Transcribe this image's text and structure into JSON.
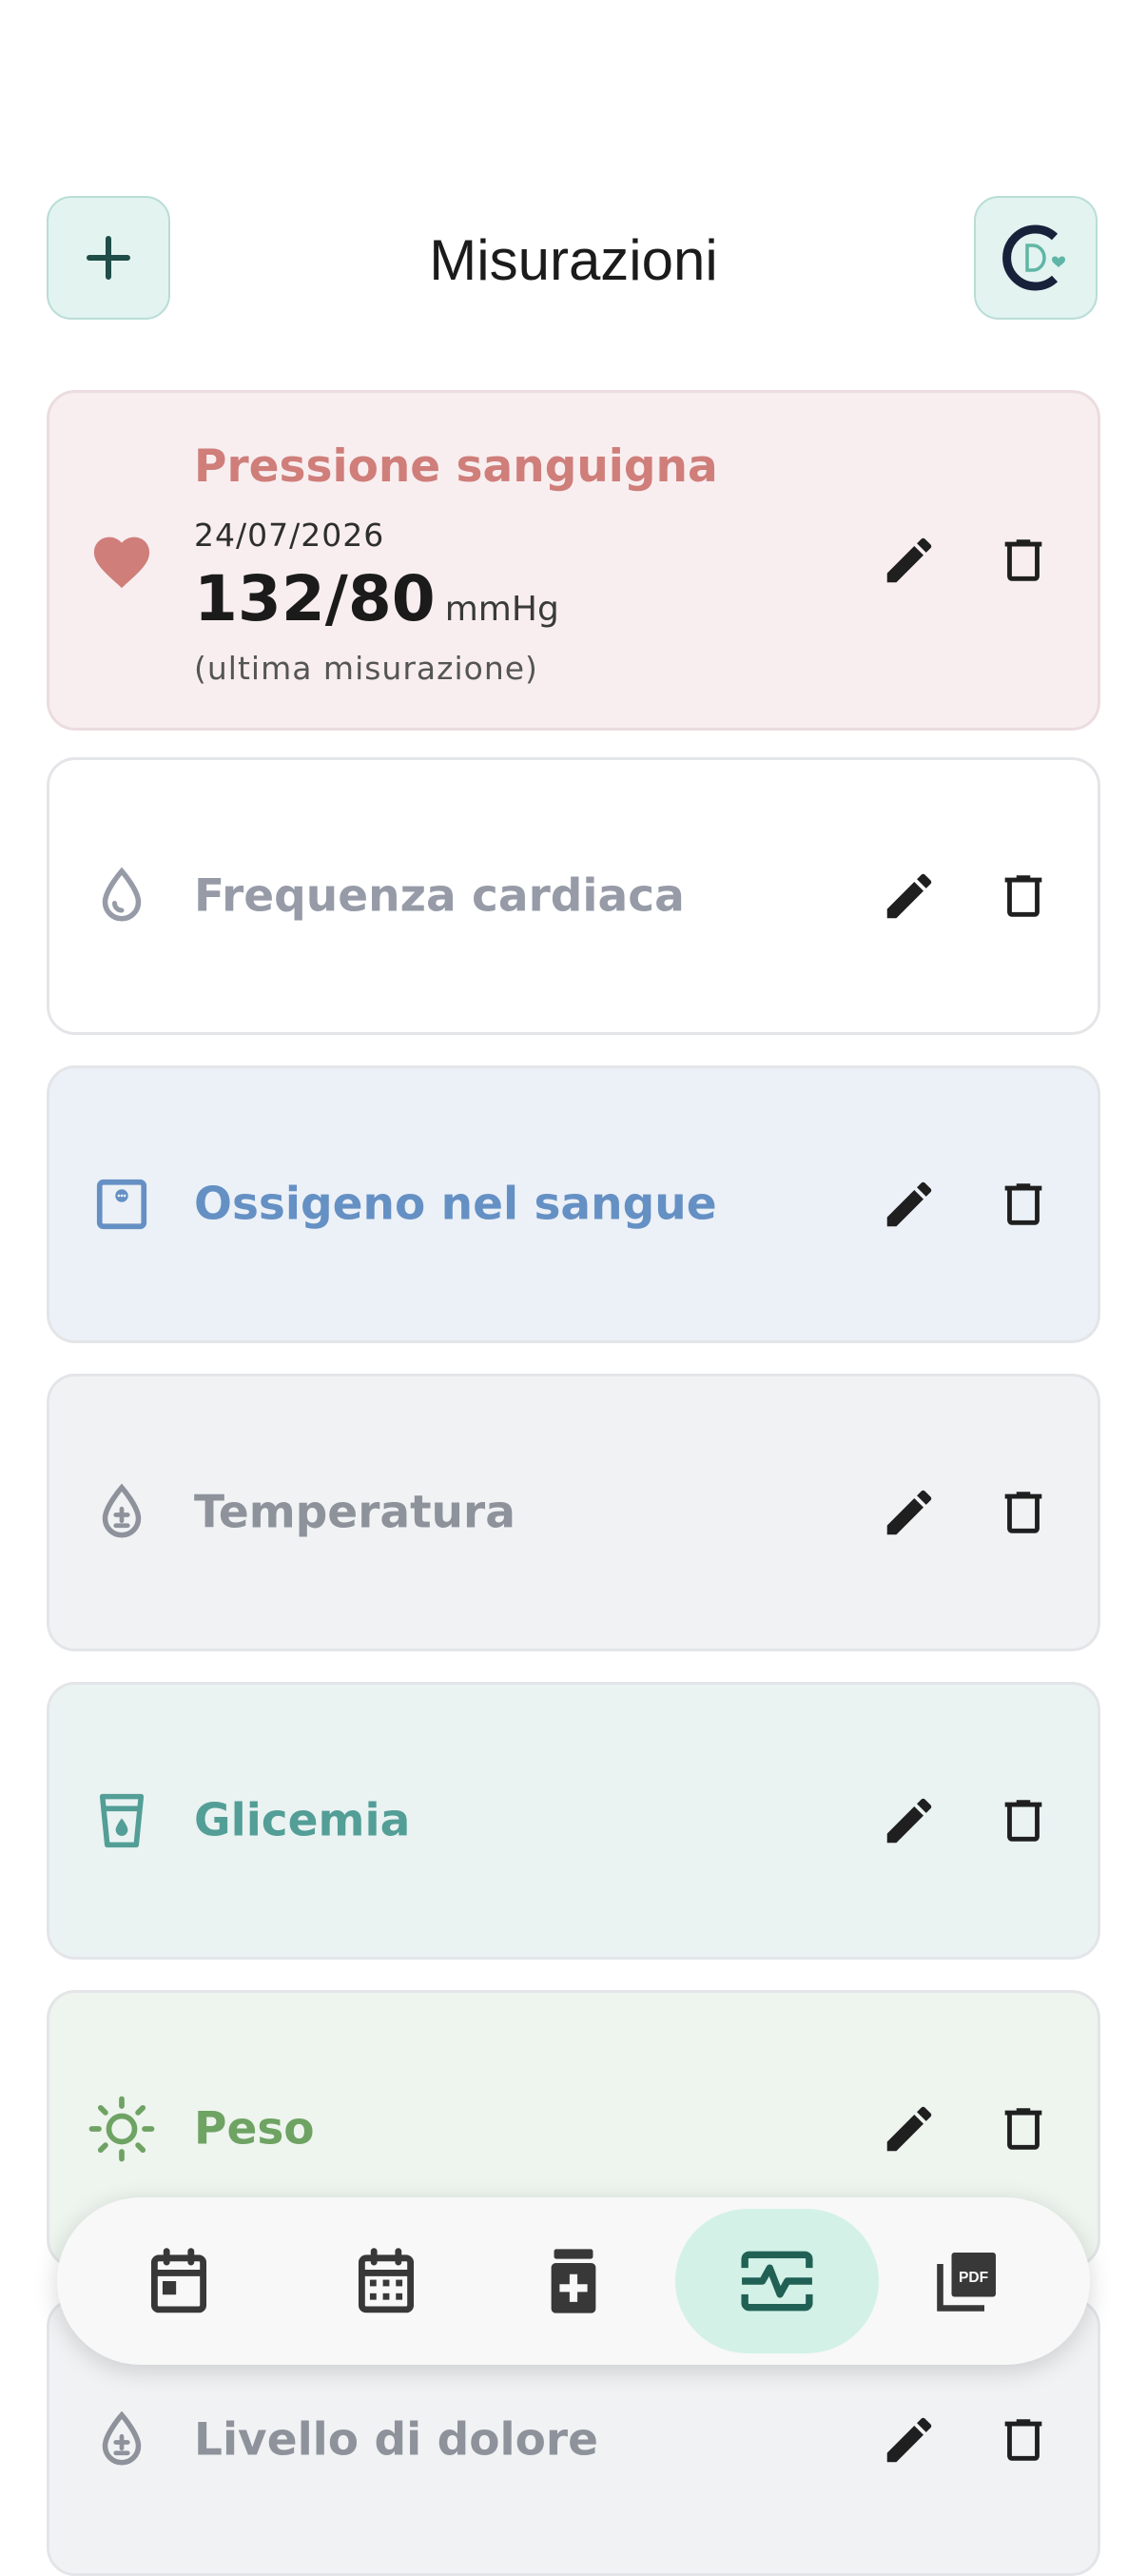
{
  "header": {
    "title": "Misurazioni",
    "add_icon": "plus-icon",
    "logo_icon": "app-logo-icon"
  },
  "cards": [
    {
      "name": "Pressione sanguigna",
      "date": "24/07/2026",
      "value": "132/80",
      "unit": "mmHg",
      "note": "(ultima misurazione)",
      "icon": "heart-icon",
      "name_color": "#cf7e7a",
      "background": "#f8eef0"
    },
    {
      "name": "Frequenza cardiaca",
      "icon": "water-drop-icon",
      "name_color": "#969ba7",
      "background": "#ffffff"
    },
    {
      "name": "Ossigeno nel sangue",
      "icon": "oximeter-icon",
      "name_color": "#6590c4",
      "background": "#ecf1f7"
    },
    {
      "name": "Temperatura",
      "icon": "thermometer-drop-icon",
      "name_color": "#8d929b",
      "background": "#f1f2f4"
    },
    {
      "name": "Glicemia",
      "icon": "glucose-cup-icon",
      "name_color": "#539e96",
      "background": "#eaf3f2"
    },
    {
      "name": "Peso",
      "icon": "sun-icon",
      "name_color": "#6ea363",
      "background": "#eef4ee"
    },
    {
      "name": "Livello di dolore",
      "icon": "pain-drop-icon",
      "name_color": "#8d929b",
      "background": "#f1f2f4"
    }
  ],
  "actions": {
    "edit_icon": "pencil-icon",
    "delete_icon": "trash-icon"
  },
  "navbar": {
    "items": [
      {
        "icon": "calendar-day-icon",
        "active": false
      },
      {
        "icon": "calendar-month-icon",
        "active": false
      },
      {
        "icon": "medication-icon",
        "active": false
      },
      {
        "icon": "monitor-heart-icon",
        "active": true
      },
      {
        "icon": "pdf-icon",
        "active": false
      }
    ],
    "accent": "#d3f1e7"
  }
}
